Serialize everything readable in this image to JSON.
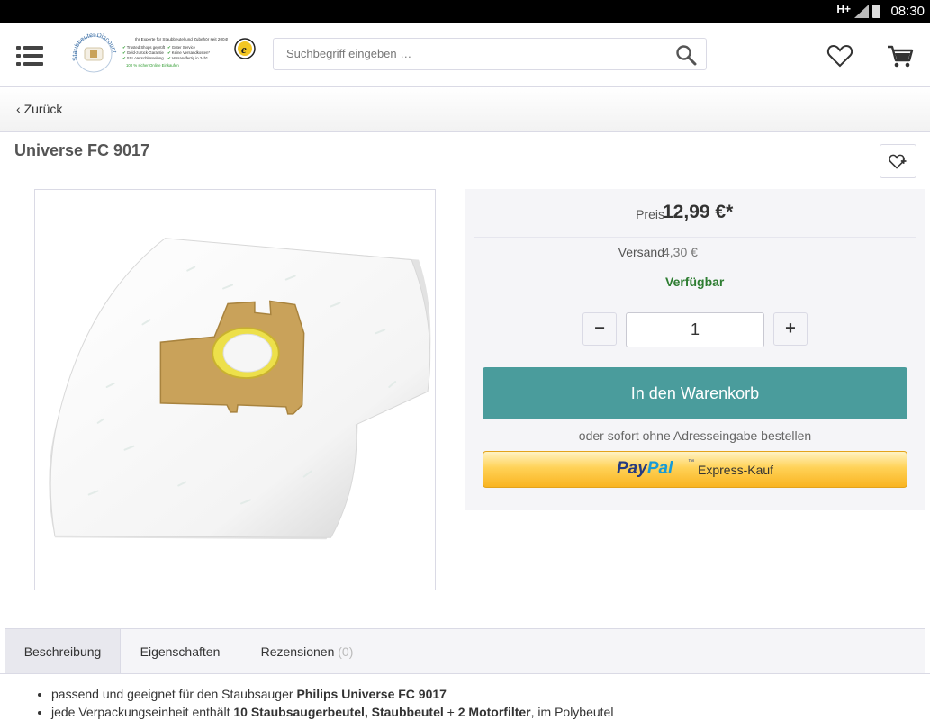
{
  "status_bar": {
    "network": "H+",
    "time": "08:30"
  },
  "header": {
    "search_placeholder": "Suchbegriff eingeben …",
    "logo_top_line": "Ihr Experte für Staubbeutel und Zubehör seit 2004!",
    "logo_checks": [
      "Trusted Shops geprüft",
      "Geld-zurück-Garantie",
      "SSL-Verschlüsselung",
      "Guter Service",
      "Keine Versandkosten*",
      "Versandfertig in 24h*"
    ],
    "logo_bottom_line": "100 % sicher Online Einkaufen",
    "logo_arc_text": "Staubbeutel-Discount"
  },
  "nav": {
    "back_label": "Zurück"
  },
  "product": {
    "title": "Universe FC 9017"
  },
  "buybox": {
    "price_label": "Preis",
    "price_value": "12,99 €*",
    "shipping_label": "Versand",
    "shipping_value": "4,30 €",
    "availability": "Verfügbar",
    "quantity": "1",
    "minus_label": "−",
    "plus_label": "+",
    "add_to_cart_label": "In den Warenkorb",
    "or_text": "oder sofort ohne Adresseingabe bestellen",
    "paypal_brand_a": "Pay",
    "paypal_brand_b": "Pal",
    "paypal_tm": "™",
    "paypal_label": "Express-Kauf"
  },
  "tabs": [
    {
      "label": "Beschreibung"
    },
    {
      "label": "Eigenschaften"
    },
    {
      "label": "Rezensionen",
      "count": "(0)"
    }
  ],
  "description": {
    "line1_prefix": "passend und geeignet für den Staubsauger ",
    "line1_bold": "Philips Universe FC 9017",
    "line2_prefix": "jede Verpackungseinheit enthält ",
    "line2_bold1": "10 Staubsaugerbeutel, Staubbeutel",
    "line2_mid": " + ",
    "line2_bold2": "2 Motorfilter",
    "line2_suffix": ", im Polybeutel"
  },
  "colors": {
    "accent_teal": "#4a9c9c",
    "available_green": "#2e7d32",
    "paypal_dark": "#253b80",
    "paypal_light": "#179bd7"
  }
}
